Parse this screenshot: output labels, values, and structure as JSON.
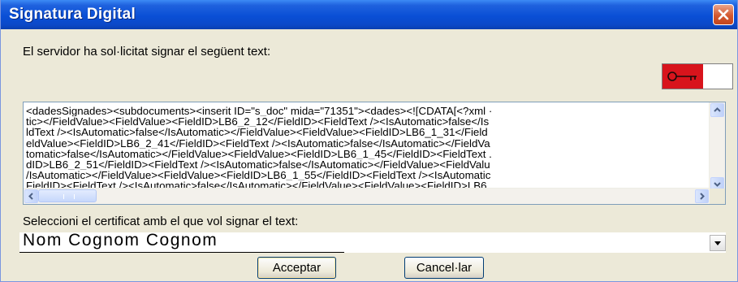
{
  "window": {
    "title": "Signatura Digital"
  },
  "prompt": "El servidor ha sol·licitat signar el següent text:",
  "signed_text": {
    "lines": [
      "<dadesSignades><subdocuments><inserit ID=\"s_doc\" mida=\"71351\"><dades><![CDATA[<?xml ·",
      "tic></FieldValue><FieldValue><FieldID>LB6_2_12</FieldID><FieldText /><IsAutomatic>false</Is",
      "ldText /><IsAutomatic>false</IsAutomatic></FieldValue><FieldValue><FieldID>LB6_1_31</Field",
      "eldValue><FieldID>LB6_2_41</FieldID><FieldText /><IsAutomatic>false</IsAutomatic></FieldVa",
      "tomatic>false</IsAutomatic></FieldValue><FieldValue><FieldID>LB6_1_45</FieldID><FieldText .",
      "dID>LB6_2_51</FieldID><FieldText /><IsAutomatic>false</IsAutomatic></FieldValue><FieldValu",
      "/IsAutomatic></FieldValue><FieldValue><FieldID>LB6_1_55</FieldID><FieldText /><IsAutomatic",
      "FieldID><FieldText /><IsAutomatic>false</IsAutomatic></FieldValue><FieldValue><FieldID>LB6_"
    ]
  },
  "certificate": {
    "label": "Seleccioni el certificat amb el que vol signar el text:",
    "selected": "Nom Cognom Cognom"
  },
  "buttons": {
    "accept": "Acceptar",
    "cancel": "Cancel·lar"
  },
  "icons": {
    "close": "close-icon",
    "key": "key-icon",
    "scroll_up": "arrow-up-icon",
    "scroll_down": "arrow-down-icon",
    "scroll_left": "arrow-left-icon",
    "scroll_right": "arrow-right-icon",
    "dropdown": "chevron-down-icon"
  },
  "colors": {
    "titlebar": "#0a4fd6",
    "close": "#d4582f",
    "key_bg": "#d8141c"
  }
}
